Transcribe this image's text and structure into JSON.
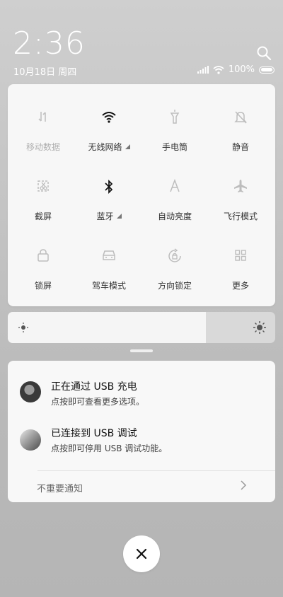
{
  "status": {
    "time": "2:36",
    "date": "10月18日 周四",
    "battery": "100%"
  },
  "quick_settings": {
    "tiles": [
      {
        "label": "移动数据",
        "icon": "mobile-data-icon",
        "active": false
      },
      {
        "label": "无线网络",
        "icon": "wifi-icon",
        "active": true
      },
      {
        "label": "手电筒",
        "icon": "flashlight-icon",
        "active": false
      },
      {
        "label": "静音",
        "icon": "mute-icon",
        "active": false
      },
      {
        "label": "截屏",
        "icon": "screenshot-icon",
        "active": false
      },
      {
        "label": "蓝牙",
        "icon": "bluetooth-icon",
        "active": true
      },
      {
        "label": "自动亮度",
        "icon": "auto-brightness-icon",
        "active": false
      },
      {
        "label": "飞行模式",
        "icon": "airplane-icon",
        "active": false
      },
      {
        "label": "锁屏",
        "icon": "lock-icon",
        "active": false
      },
      {
        "label": "驾车模式",
        "icon": "car-icon",
        "active": false
      },
      {
        "label": "方向锁定",
        "icon": "rotation-lock-icon",
        "active": false
      },
      {
        "label": "更多",
        "icon": "more-grid-icon",
        "active": false
      }
    ]
  },
  "brightness": {
    "level": 0.74
  },
  "notifications": {
    "items": [
      {
        "title": "正在通过 USB 充电",
        "text": "点按即可查看更多选项。"
      },
      {
        "title": "已连接到 USB 调试",
        "text": "点按即可停用 USB 调试功能。"
      }
    ],
    "unimportant_label": "不重要通知"
  }
}
